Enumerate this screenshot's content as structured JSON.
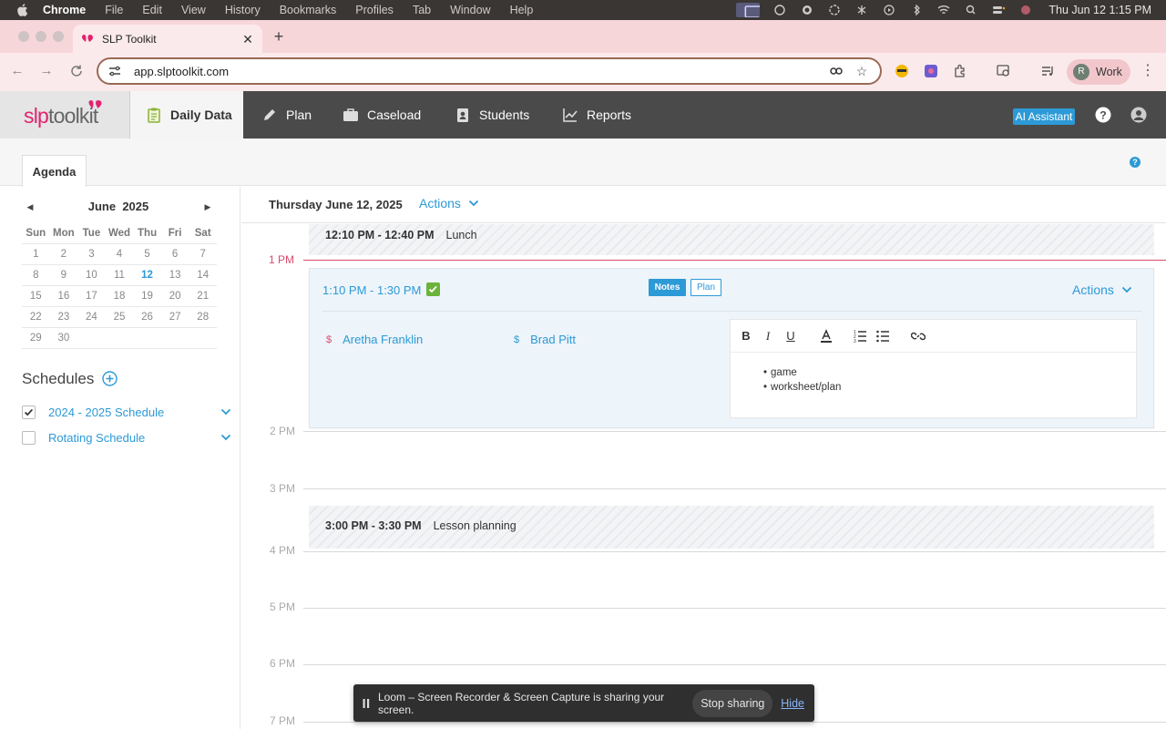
{
  "mac_menubar": {
    "app_name": "Chrome",
    "menus": [
      "File",
      "Edit",
      "View",
      "History",
      "Bookmarks",
      "Profiles",
      "Tab",
      "Window",
      "Help"
    ],
    "clock": "Thu Jun 12  1:15 PM"
  },
  "browser": {
    "tab_title": "SLP Toolkit",
    "url": "app.slptoolkit.com",
    "profile_initial": "R",
    "profile_name": "Work"
  },
  "app": {
    "logo_slp": "slp",
    "logo_toolkit": "toolkit",
    "nav": [
      {
        "label": "Daily Data",
        "icon": "clipboard-icon"
      },
      {
        "label": "Plan",
        "icon": "pencil-icon"
      },
      {
        "label": "Caseload",
        "icon": "briefcase-icon"
      },
      {
        "label": "Students",
        "icon": "id-badge-icon"
      },
      {
        "label": "Reports",
        "icon": "line-chart-icon"
      }
    ],
    "ai_assistant": "AI Assistant",
    "accent_color": "#2c9ad6",
    "brand_color": "#e2236e"
  },
  "subheader": {
    "tab": "Agenda"
  },
  "calendar": {
    "month": "June",
    "year": "2025",
    "weekdays": [
      "Sun",
      "Mon",
      "Tue",
      "Wed",
      "Thu",
      "Fri",
      "Sat"
    ],
    "weeks": [
      [
        "1",
        "2",
        "3",
        "4",
        "5",
        "6",
        "7"
      ],
      [
        "8",
        "9",
        "10",
        "11",
        "12",
        "13",
        "14"
      ],
      [
        "15",
        "16",
        "17",
        "18",
        "19",
        "20",
        "21"
      ],
      [
        "22",
        "23",
        "24",
        "25",
        "26",
        "27",
        "28"
      ],
      [
        "29",
        "30",
        "",
        "",
        "",
        "",
        ""
      ]
    ],
    "today": "12"
  },
  "schedules": {
    "title": "Schedules",
    "items": [
      {
        "label": "2024 - 2025 Schedule",
        "checked": true
      },
      {
        "label": "Rotating Schedule",
        "checked": false
      }
    ]
  },
  "agenda": {
    "date": "Thursday June 12, 2025",
    "actions_label": "Actions",
    "hours": [
      "1 PM",
      "2 PM",
      "3 PM",
      "4 PM",
      "5 PM",
      "6 PM",
      "7 PM"
    ],
    "events": [
      {
        "time": "12:10 PM - 12:40 PM",
        "title": "Lunch"
      },
      {
        "time": "3:00 PM - 3:30 PM",
        "title": "Lesson planning"
      }
    ],
    "session": {
      "time": "1:10 PM - 1:30 PM",
      "notes_label": "Notes",
      "plan_label": "Plan",
      "actions_label": "Actions",
      "students": [
        {
          "name": "Aretha Franklin",
          "symbol": "$"
        },
        {
          "name": "Brad Pitt",
          "symbol": "$"
        }
      ],
      "notes": [
        "game",
        "worksheet/plan"
      ]
    }
  },
  "loom_bar": {
    "message": "Loom – Screen Recorder & Screen Capture is sharing your screen.",
    "stop_label": "Stop sharing",
    "hide_label": "Hide"
  }
}
